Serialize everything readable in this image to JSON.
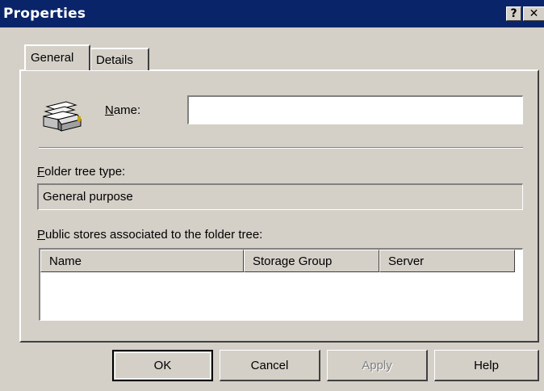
{
  "window": {
    "title": "Properties",
    "help_button_label": "?",
    "close_button_label": "✕"
  },
  "tabs": [
    {
      "label": "General",
      "selected": true
    },
    {
      "label": "Details",
      "selected": false
    }
  ],
  "general": {
    "icon": "folder-tree-icon",
    "name_label_mnemonic": "N",
    "name_label_rest": "ame:",
    "name_value": "",
    "folder_tree_type_label_mnemonic": "F",
    "folder_tree_type_label_rest": "older tree type:",
    "folder_tree_type_value": "General purpose",
    "public_stores_label_mnemonic": "P",
    "public_stores_label_rest": "ublic stores associated to the folder tree:",
    "public_stores_columns": [
      "Name",
      "Storage Group",
      "Server"
    ],
    "public_stores_rows": []
  },
  "buttons": {
    "ok": "OK",
    "cancel": "Cancel",
    "apply": "Apply",
    "help": "Help"
  },
  "colors": {
    "titlebar": "#0a246a",
    "face": "#d4d0c8"
  }
}
